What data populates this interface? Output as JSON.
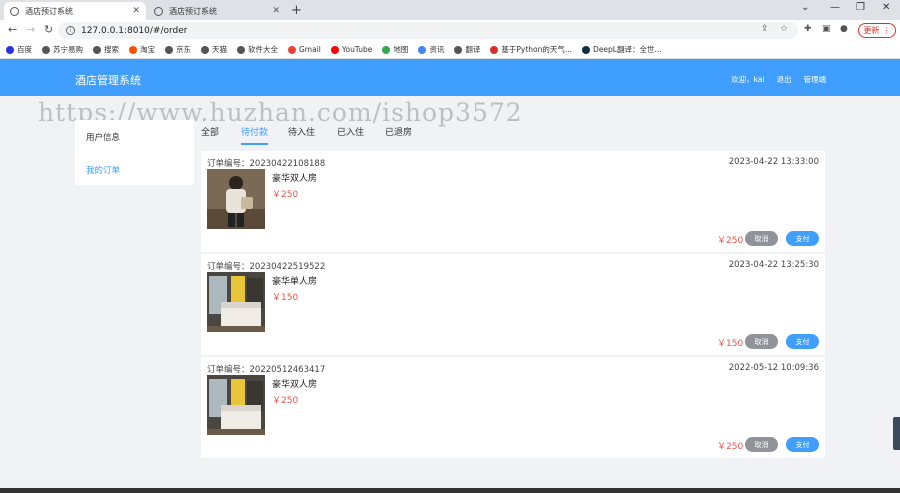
{
  "browser": {
    "tabs": [
      {
        "title": "酒店预订系统",
        "active": true
      },
      {
        "title": "酒店预订系统",
        "active": false
      }
    ],
    "url": "127.0.0.1:8010/#/order",
    "update_label": "更新",
    "bookmarks": [
      {
        "label": "百度",
        "color": "#2932e1"
      },
      {
        "label": "苏宁易购",
        "color": "#555555"
      },
      {
        "label": "搜索",
        "color": "#555555"
      },
      {
        "label": "淘宝",
        "color": "#ff5000"
      },
      {
        "label": "京东",
        "color": "#555555"
      },
      {
        "label": "天猫",
        "color": "#555555"
      },
      {
        "label": "软件大全",
        "color": "#555555"
      },
      {
        "label": "Gmail",
        "color": "#ea4335"
      },
      {
        "label": "YouTube",
        "color": "#ff0000"
      },
      {
        "label": "地图",
        "color": "#34a853"
      },
      {
        "label": "资讯",
        "color": "#4285f4"
      },
      {
        "label": "翻译",
        "color": "#555555"
      },
      {
        "label": "基于Python的天气...",
        "color": "#d93025"
      },
      {
        "label": "DeepL翻译：全世...",
        "color": "#0f2b46"
      }
    ]
  },
  "app": {
    "title": "酒店管理系统",
    "welcome": "欢迎，kai",
    "logout": "退出",
    "admin": "管理端",
    "accent": "#409eff"
  },
  "watermark": "https://www.huzhan.com/ishop3572",
  "sidebar": {
    "user_info": "用户信息",
    "my_orders": "我的订单"
  },
  "status_tabs": [
    {
      "label": "全部",
      "active": false
    },
    {
      "label": "待付款",
      "active": true
    },
    {
      "label": "待入住",
      "active": false
    },
    {
      "label": "已入住",
      "active": false
    },
    {
      "label": "已退房",
      "active": false
    }
  ],
  "order_labels": {
    "number_prefix": "订单编号：",
    "cancel": "取消",
    "pay": "支付"
  },
  "orders": [
    {
      "number": "20230422108188",
      "time": "2023-04-22 13:33:00",
      "room": "豪华双人房",
      "price": "￥250",
      "total": "￥250",
      "image": "person"
    },
    {
      "number": "20230422519522",
      "time": "2023-04-22 13:25:30",
      "room": "豪华单人房",
      "price": "￥150",
      "total": "￥150",
      "image": "room"
    },
    {
      "number": "20220512463417",
      "time": "2022-05-12 10:09:36",
      "room": "豪华双人房",
      "price": "￥250",
      "total": "￥250",
      "image": "room"
    }
  ]
}
